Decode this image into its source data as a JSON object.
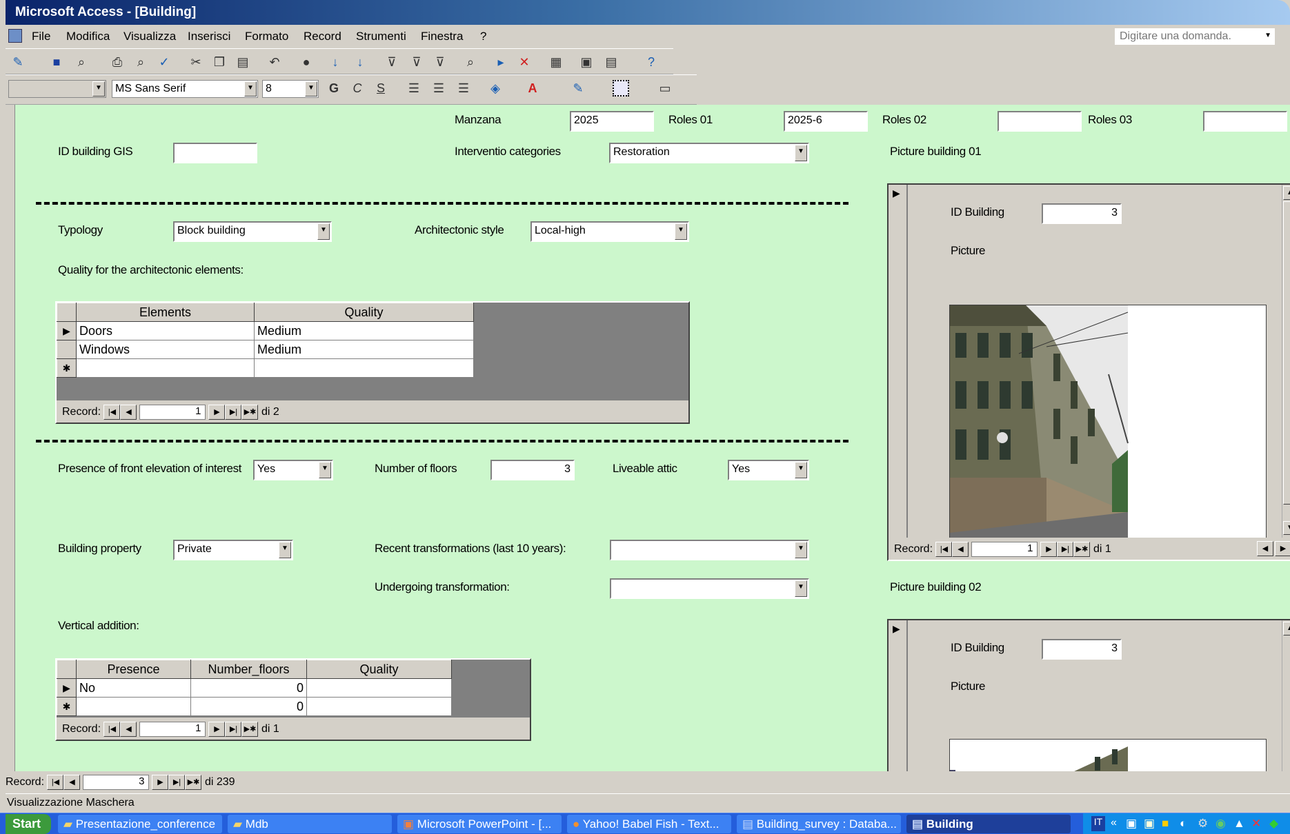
{
  "window": {
    "title": "Microsoft Access - [Building]"
  },
  "menu": [
    "File",
    "Modifica",
    "Visualizza",
    "Inserisci",
    "Formato",
    "Record",
    "Strumenti",
    "Finestra",
    "?"
  ],
  "ask_placeholder": "Digitare una domanda.",
  "format_toolbar": {
    "font": "MS Sans Serif",
    "size": "8",
    "bold": "G",
    "italic": "C",
    "underline": "S"
  },
  "form": {
    "manzana_label": "Manzana",
    "manzana_value": "2025",
    "roles01_label": "Roles 01",
    "roles01_value": "2025-6",
    "roles02_label": "Roles 02",
    "roles02_value": "",
    "roles03_label": "Roles 03",
    "roles03_value": "",
    "id_gis_label": "ID building GIS",
    "id_gis_value": "",
    "intervention_label": "Interventio categories",
    "intervention_value": "Restoration",
    "picture01_label": "Picture building 01",
    "picture02_label": "Picture building 02",
    "typology_label": "Typology",
    "typology_value": "Block building",
    "arch_style_label": "Architectonic style",
    "arch_style_value": "Local-high",
    "quality_label": "Quality for the architectonic elements:",
    "front_elev_label": "Presence of front elevation of interest",
    "front_elev_value": "Yes",
    "floors_label": "Number of floors",
    "floors_value": "3",
    "attic_label": "Liveable attic",
    "attic_value": "Yes",
    "property_label": "Building property",
    "property_value": "Private",
    "recent_label": "Recent transformations (last 10 years):",
    "recent_value": "",
    "undergoing_label": "Undergoing transformation:",
    "undergoing_value": "",
    "vertical_label": "Vertical addition:"
  },
  "elements_table": {
    "headers": [
      "Elements",
      "Quality"
    ],
    "rows": [
      [
        "Doors",
        "Medium"
      ],
      [
        "Windows",
        "Medium"
      ]
    ],
    "nav": {
      "label": "Record:",
      "current": "1",
      "total": "di 2"
    }
  },
  "vertical_table": {
    "headers": [
      "Presence",
      "Number_floors",
      "Quality"
    ],
    "rows": [
      [
        "No",
        "0",
        ""
      ],
      [
        "",
        "0",
        ""
      ]
    ],
    "nav": {
      "label": "Record:",
      "current": "1",
      "total": "di 1"
    }
  },
  "picture01_sub": {
    "id_label": "ID Building",
    "id_value": "3",
    "picture_label": "Picture",
    "nav": {
      "label": "Record:",
      "current": "1",
      "total": "di 1"
    }
  },
  "picture02_sub": {
    "id_label": "ID Building",
    "id_value": "3",
    "picture_label": "Picture"
  },
  "main_nav": {
    "label": "Record:",
    "current": "3",
    "total": "di 239"
  },
  "status_text": "Visualizzazione Maschera",
  "taskbar": {
    "start": "Start",
    "items": [
      "Presentazione_conference",
      "Mdb",
      "Microsoft PowerPoint - [...",
      "Yahoo! Babel Fish - Text...",
      "Building_survey : Databa...",
      "Building"
    ]
  }
}
